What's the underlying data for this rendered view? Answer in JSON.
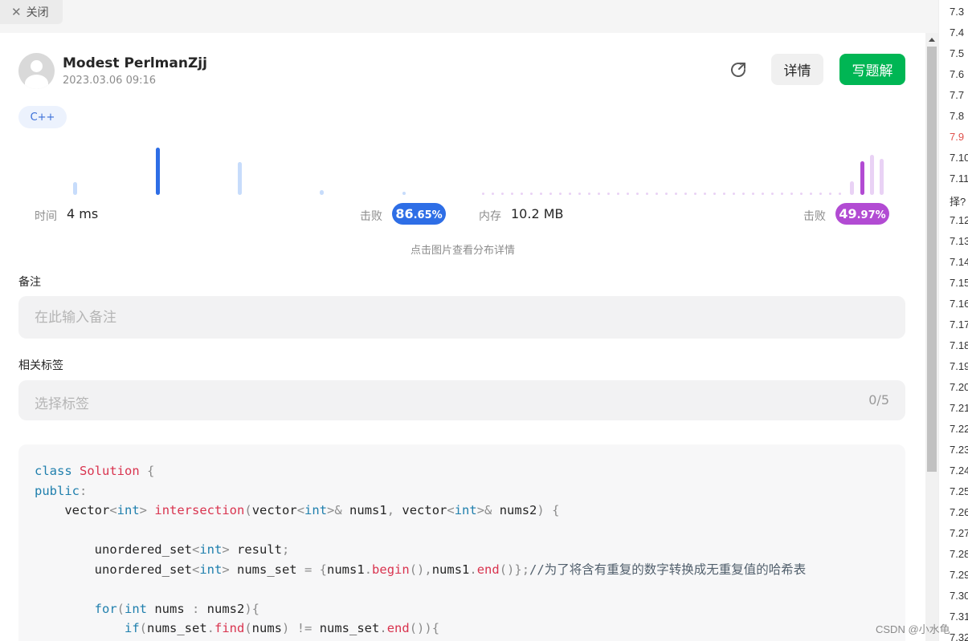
{
  "topbar": {
    "close_label": "关闭"
  },
  "header": {
    "username": "Modest PerlmanZjj",
    "datetime": "2023.03.06 09:16",
    "detail_label": "详情",
    "write_label": "写题解"
  },
  "language_tag": "C++",
  "runtime": {
    "label": "时间",
    "value": "4 ms",
    "beat_label": "击败",
    "beat_main": "86",
    "beat_decimal": ".65%",
    "beat_percent": 86.65,
    "color": "#2e6ee6",
    "light_color": "#c7dcfb"
  },
  "memory": {
    "label": "内存",
    "value": "10.2 MB",
    "beat_label": "击败",
    "beat_main": "49",
    "beat_decimal": ".97%",
    "beat_percent": 49.97,
    "color": "#b24bd3",
    "light_color": "#e9d2f5"
  },
  "chart_hint": "点击图片查看分布详情",
  "note": {
    "label": "备注",
    "placeholder": "在此输入备注"
  },
  "tags": {
    "label": "相关标签",
    "placeholder": "选择标签",
    "count": "0/5"
  },
  "code_lines": [
    "class Solution {",
    "public:",
    "    vector<int> intersection(vector<int>& nums1, vector<int>& nums2) {",
    "",
    "        unordered_set<int> result;",
    "        unordered_set<int> nums_set = {nums1.begin(),nums1.end()};//为了将含有重复的数字转换成无重复值的哈希表",
    "",
    "        for(int nums : nums2){",
    "            if(nums_set.find(nums) != nums_set.end()){"
  ],
  "toc": [
    "7.3",
    "7.4",
    "7.5",
    "7.6",
    "7.7",
    "7.8",
    "7.9",
    "7.10",
    "7.11",
    "择?",
    "7.12",
    "7.13",
    "7.14",
    "7.15",
    "7.16",
    "7.17",
    "7.18",
    "7.19",
    "7.20",
    "7.21",
    "7.22",
    "7.23",
    "7.24",
    "7.25",
    "7.26",
    "7.27",
    "7.28",
    "7.29",
    "7.30",
    "7.31",
    "7.32"
  ],
  "toc_active_index": 6,
  "watermark": "CSDN @小水龟"
}
